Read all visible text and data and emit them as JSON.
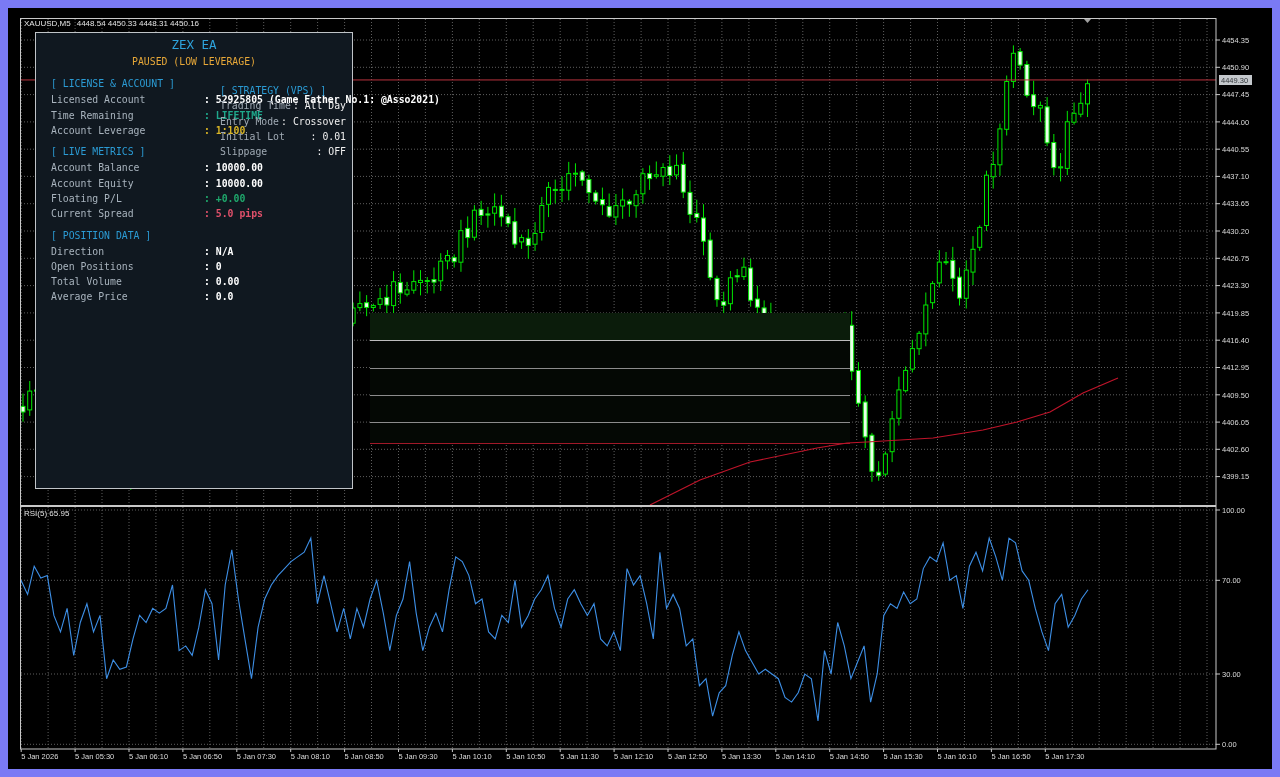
{
  "chart": {
    "symbol": "XAUUSD,M5",
    "ohlc": "4448.54 4450.33 4448.31 4450.16",
    "price_labels": [
      "4454.35",
      "4450.90",
      "4447.45",
      "4444.00",
      "4440.55",
      "4437.10",
      "4433.65",
      "4430.20",
      "4426.75",
      "4423.30",
      "4419.85",
      "4416.40",
      "4412.95",
      "4409.50",
      "4406.05",
      "4402.60",
      "4399.15"
    ],
    "current_price": "4449.30"
  },
  "ea_panel": {
    "title": "ZEX EA",
    "status": "PAUSED (LOW LEVERAGE)",
    "sections": [
      {
        "heading": "[ LICENSE & ACCOUNT ]",
        "rows": [
          {
            "label": "Licensed Account",
            "value": ": 52925805 (Game Father No.1: @Asso2021)",
            "color": "#ffffff"
          },
          {
            "label": "Time Remaining",
            "value": ": LIFETIME",
            "color": "#1fa88c"
          },
          {
            "label": "Account Leverage",
            "value": ": 1:100",
            "color": "#d9b526"
          }
        ]
      },
      {
        "heading": "[ LIVE METRICS ]",
        "rows": [
          {
            "label": "Account Balance",
            "value": ": 10000.00",
            "color": "#ffffff"
          },
          {
            "label": "Account Equity",
            "value": ": 10000.00",
            "color": "#ffffff"
          },
          {
            "label": "Floating P/L",
            "value": ": +0.00",
            "color": "#1fa86c"
          },
          {
            "label": "Current Spread",
            "value": ": 5.0 pips",
            "color": "#e0506a"
          }
        ]
      },
      {
        "heading": "[ POSITION DATA ]",
        "rows": [
          {
            "label": "Direction",
            "value": ": N/A",
            "color": "#ffffff"
          },
          {
            "label": "Open Positions",
            "value": ": 0",
            "color": "#ffffff"
          },
          {
            "label": "Total Volume",
            "value": ": 0.00",
            "color": "#ffffff"
          },
          {
            "label": "Average Price",
            "value": ": 0.0",
            "color": "#ffffff"
          }
        ]
      }
    ],
    "strategy": {
      "heading": "[ STRATEGY (VPS) ]",
      "rows": [
        {
          "label": "Trading Time",
          "value": ": All Day"
        },
        {
          "label": "Entry Mode",
          "value": ": Crossover"
        },
        {
          "label": "Initial Lot",
          "value": ": 0.01"
        },
        {
          "label": "Slippage",
          "value": ": OFF"
        }
      ]
    }
  },
  "rsi": {
    "chart_data": {
      "type": "line",
      "title": "RSI(5) 65.95",
      "ylim": [
        -2,
        101.5
      ],
      "yticks": [
        {
          "value": 100,
          "label": "100.00"
        },
        {
          "value": 70,
          "label": "70.00"
        },
        {
          "value": 30,
          "label": "30.00"
        },
        {
          "value": 0,
          "label": "0.00"
        }
      ],
      "grid": true,
      "series": [
        {
          "color": "#3d8fe6",
          "values": [
            70,
            64,
            76,
            71,
            72,
            55,
            48,
            58,
            38,
            52,
            60,
            48,
            55,
            28,
            36,
            32,
            33,
            45,
            55,
            52,
            58,
            56,
            58,
            68,
            40,
            42,
            38,
            50,
            66,
            60,
            36,
            68,
            83,
            62,
            45,
            28,
            50,
            62,
            68,
            72,
            75,
            78,
            80,
            82,
            88,
            60,
            72,
            60,
            48,
            58,
            45,
            58,
            50,
            62,
            70,
            56,
            40,
            55,
            62,
            78,
            56,
            40,
            50,
            56,
            48,
            66,
            80,
            78,
            72,
            60,
            62,
            48,
            45,
            55,
            52,
            70,
            50,
            55,
            62,
            66,
            72,
            58,
            50,
            62,
            66,
            60,
            55,
            60,
            45,
            42,
            48,
            40,
            75,
            68,
            72,
            60,
            45,
            82,
            58,
            64,
            58,
            42,
            45,
            25,
            28,
            12,
            22,
            25,
            38,
            48,
            40,
            35,
            30,
            32,
            30,
            28,
            20,
            18,
            22,
            30,
            28,
            10,
            40,
            30,
            52,
            42,
            28,
            35,
            42,
            18,
            30,
            55,
            60,
            58,
            65,
            60,
            62,
            75,
            80,
            78,
            86,
            70,
            72,
            58,
            76,
            82,
            74,
            88,
            80,
            70,
            88,
            86,
            74,
            70,
            58,
            48,
            40,
            60,
            64,
            50,
            55,
            62,
            66
          ]
        }
      ]
    }
  },
  "time_axis": {
    "labels": [
      "5 Jan 2026",
      "5 Jan 05:30",
      "5 Jan 06:10",
      "5 Jan 06:50",
      "5 Jan 07:30",
      "5 Jan 08:10",
      "5 Jan 08:50",
      "5 Jan 09:30",
      "5 Jan 10:10",
      "5 Jan 10:50",
      "5 Jan 11:30",
      "5 Jan 12:10",
      "5 Jan 12:50",
      "5 Jan 13:30",
      "5 Jan 14:10",
      "5 Jan 14:50",
      "5 Jan 15:30",
      "5 Jan 16:10",
      "5 Jan 16:50",
      "5 Jan 17:30"
    ]
  }
}
